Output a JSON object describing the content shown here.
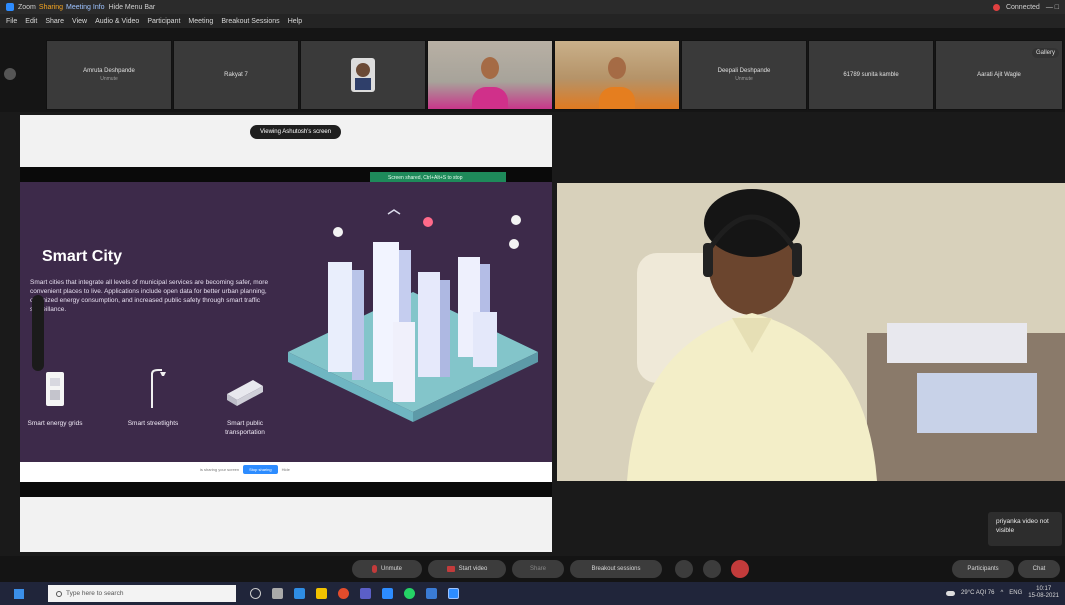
{
  "window": {
    "app_name": "Zoom",
    "title_segment_1": "Sharing",
    "meeting_label": "Meeting Info",
    "menu_label": "Hide Menu Bar",
    "connected": "Connected",
    "window_controls": "—  □"
  },
  "menubar": [
    "File",
    "Edit",
    "Share",
    "View",
    "Audio & Video",
    "Participant",
    "Meeting",
    "Breakout Sessions",
    "Help"
  ],
  "participants": [
    {
      "name": "Amruta Deshpande",
      "sub": "Unmute",
      "kind": "name"
    },
    {
      "name": "Rakyat 7",
      "sub": "",
      "kind": "name"
    },
    {
      "name": "",
      "sub": "",
      "kind": "avatar"
    },
    {
      "name": "",
      "sub": "",
      "kind": "video1"
    },
    {
      "name": "",
      "sub": "",
      "kind": "video2"
    },
    {
      "name": "Deepali Deshpande",
      "sub": "Unmute",
      "kind": "name"
    },
    {
      "name": "61789 sunita kamble",
      "sub": "",
      "kind": "name"
    },
    {
      "name": "Aarati Ajit Wagle",
      "sub": "",
      "kind": "name"
    }
  ],
  "strip_right_pill": "Gallery",
  "share": {
    "viewing_label": "Viewing Ashutosh's screen",
    "green_note": "Screen shared, Ctrl+Alt+S to stop",
    "slide_title": "Smart City",
    "slide_text": "Smart cities that integrate all levels of municipal services are becoming safer, more convenient places to live. Applications include open data for better urban planning, optimized energy consumption, and increased public safety through smart traffic surveillance.",
    "features": [
      {
        "label": "Smart energy grids",
        "icon": "energy-grid-icon"
      },
      {
        "label": "Smart streetlights",
        "icon": "streetlight-icon"
      },
      {
        "label": "Smart public transportation",
        "icon": "bus-icon"
      }
    ],
    "bottom_bar_text": "is sharing your screen",
    "bottom_bar_button": "Stop sharing",
    "bottom_bar_hide": "Hide"
  },
  "popup": {
    "text": "priyanka video not visible"
  },
  "controls": {
    "unmute": "Unmute",
    "start_video": "Start video",
    "share": "Share",
    "breakout": "Breakout sessions",
    "participants": "Participants",
    "chat": "Chat"
  },
  "taskbar": {
    "search_placeholder": "Type here to search",
    "weather": "29°C AQI 76",
    "lang": "ENG",
    "time": "10:17",
    "date": "15-08-2021"
  },
  "colors": {
    "accent": "#2d8cff",
    "slide_bg": "#3d2a4a",
    "end_red": "#c23b3b",
    "green_note": "#1e8a5a"
  }
}
